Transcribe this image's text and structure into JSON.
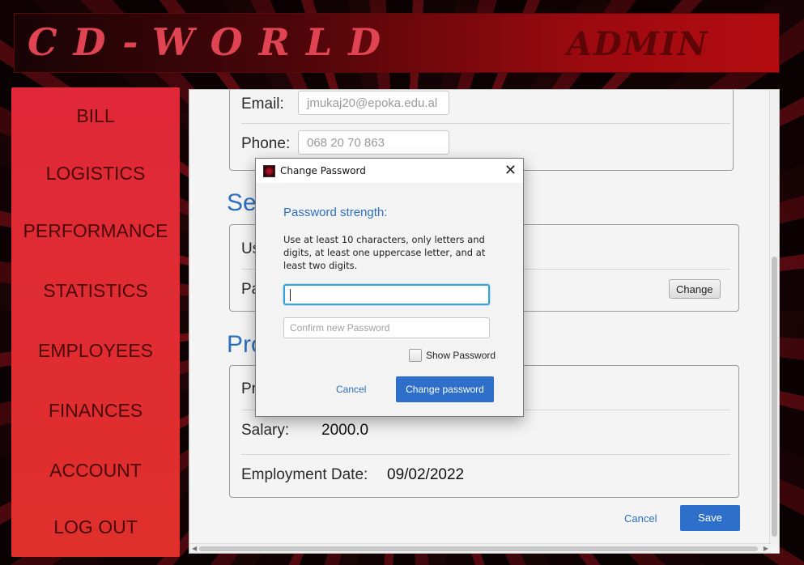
{
  "header": {
    "logo": "CD-WORLD",
    "role": "ADMIN"
  },
  "sidebar": {
    "items": [
      {
        "label": "BILL"
      },
      {
        "label": "LOGISTICS"
      },
      {
        "label": "PERFORMANCE"
      },
      {
        "label": "STATISTICS"
      },
      {
        "label": "EMPLOYEES"
      },
      {
        "label": "FINANCES"
      },
      {
        "label": "ACCOUNT"
      },
      {
        "label": "LOG OUT"
      }
    ]
  },
  "contact": {
    "email_label": "Email:",
    "email_value": "jmukaj20@epoka.edu.al",
    "phone_label": "Phone:",
    "phone_value": "068 20 70 863"
  },
  "security": {
    "title_visible": "Sec",
    "username_label_visible": "Us",
    "password_label_visible": "Pa",
    "change_label": "Change"
  },
  "professional": {
    "title_visible": "Pro",
    "position_label_visible": "Pr",
    "salary_label": "Salary:",
    "salary_value": "2000.0",
    "employment_label": "Employment Date:",
    "employment_value": "09/02/2022"
  },
  "footer": {
    "cancel_label": "Cancel",
    "save_label": "Save"
  },
  "dialog": {
    "title": "Change Password",
    "strength_label": "Password strength:",
    "help_text": "Use at least 10 characters, only letters and digits, at least one uppercase letter, and at least two digits.",
    "new_password_value": "",
    "confirm_placeholder": "Confirm new Password",
    "show_password_label": "Show Password",
    "show_password_checked": false,
    "cancel_label": "Cancel",
    "submit_label": "Change password"
  },
  "colors": {
    "accent_blue": "#2e6fcb",
    "sidebar_red": "#e02838",
    "sidebar_text": "#4a0a0a"
  }
}
